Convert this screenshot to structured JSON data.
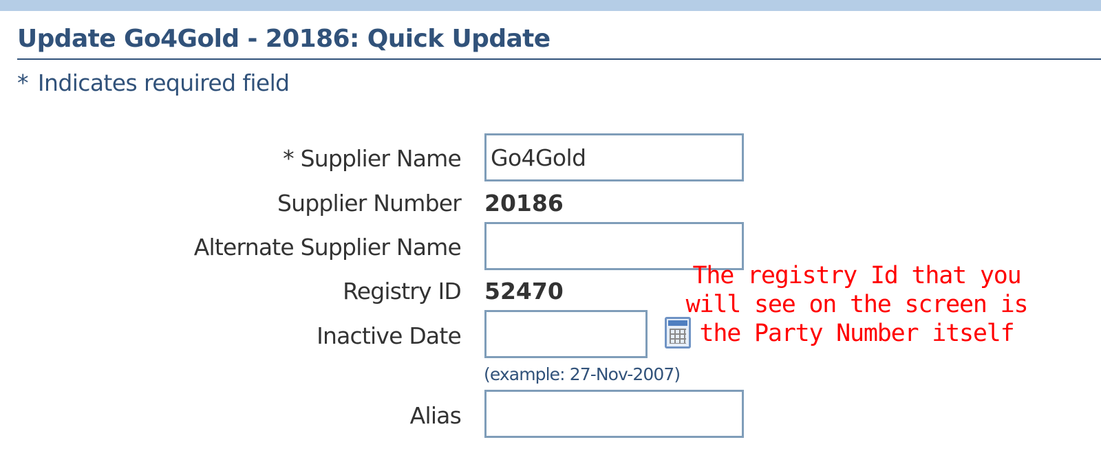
{
  "header": {
    "title": "Update Go4Gold - 20186: Quick Update",
    "required_note": "Indicates required field",
    "required_marker": "*"
  },
  "form": {
    "supplier_name": {
      "label": "Supplier Name",
      "required_marker": "*",
      "value": "Go4Gold"
    },
    "supplier_number": {
      "label": "Supplier Number",
      "value": "20186"
    },
    "alternate_supplier_name": {
      "label": "Alternate Supplier Name",
      "value": ""
    },
    "registry_id": {
      "label": "Registry ID",
      "value": "52470"
    },
    "inactive_date": {
      "label": "Inactive Date",
      "value": "",
      "hint": "(example: 27-Nov-2007)",
      "icon": "calendar-icon"
    },
    "alias": {
      "label": "Alias",
      "value": ""
    }
  },
  "annotation": {
    "lines": [
      "The registry Id that you",
      "will see on the screen is",
      "the Party Number itself"
    ],
    "color": "#ff0000"
  },
  "colors": {
    "header_text": "#31527a",
    "top_bar": "#b5cde6",
    "input_border": "#7f9db9"
  }
}
